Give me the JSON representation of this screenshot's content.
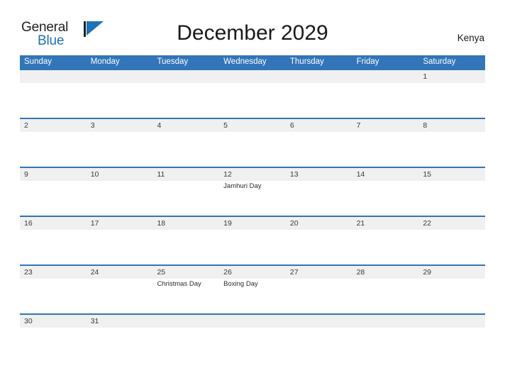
{
  "brand": {
    "name_part1": "General",
    "name_part2": "Blue",
    "mark": "triangle-flag-icon",
    "accent_color": "#1e72b8"
  },
  "header": {
    "title": "December 2029",
    "country": "Kenya"
  },
  "colors": {
    "header_blue": "#3275b8",
    "row_separator_blue": "#3275b8",
    "date_band_gray": "#f0f0f0",
    "cell_white": "#ffffff",
    "text_dark": "#1a1a1a"
  },
  "calendar": {
    "month": "December",
    "year": "2029",
    "weekday_headers": [
      "Sunday",
      "Monday",
      "Tuesday",
      "Wednesday",
      "Thursday",
      "Friday",
      "Saturday"
    ],
    "weeks": [
      {
        "days": [
          {
            "date": "",
            "event": ""
          },
          {
            "date": "",
            "event": ""
          },
          {
            "date": "",
            "event": ""
          },
          {
            "date": "",
            "event": ""
          },
          {
            "date": "",
            "event": ""
          },
          {
            "date": "",
            "event": ""
          },
          {
            "date": "1",
            "event": ""
          }
        ]
      },
      {
        "days": [
          {
            "date": "2",
            "event": ""
          },
          {
            "date": "3",
            "event": ""
          },
          {
            "date": "4",
            "event": ""
          },
          {
            "date": "5",
            "event": ""
          },
          {
            "date": "6",
            "event": ""
          },
          {
            "date": "7",
            "event": ""
          },
          {
            "date": "8",
            "event": ""
          }
        ]
      },
      {
        "days": [
          {
            "date": "9",
            "event": ""
          },
          {
            "date": "10",
            "event": ""
          },
          {
            "date": "11",
            "event": ""
          },
          {
            "date": "12",
            "event": "Jamhuri Day"
          },
          {
            "date": "13",
            "event": ""
          },
          {
            "date": "14",
            "event": ""
          },
          {
            "date": "15",
            "event": ""
          }
        ]
      },
      {
        "days": [
          {
            "date": "16",
            "event": ""
          },
          {
            "date": "17",
            "event": ""
          },
          {
            "date": "18",
            "event": ""
          },
          {
            "date": "19",
            "event": ""
          },
          {
            "date": "20",
            "event": ""
          },
          {
            "date": "21",
            "event": ""
          },
          {
            "date": "22",
            "event": ""
          }
        ]
      },
      {
        "days": [
          {
            "date": "23",
            "event": ""
          },
          {
            "date": "24",
            "event": ""
          },
          {
            "date": "25",
            "event": "Christmas Day"
          },
          {
            "date": "26",
            "event": "Boxing Day"
          },
          {
            "date": "27",
            "event": ""
          },
          {
            "date": "28",
            "event": ""
          },
          {
            "date": "29",
            "event": ""
          }
        ]
      },
      {
        "days": [
          {
            "date": "30",
            "event": ""
          },
          {
            "date": "31",
            "event": ""
          },
          {
            "date": "",
            "event": ""
          },
          {
            "date": "",
            "event": ""
          },
          {
            "date": "",
            "event": ""
          },
          {
            "date": "",
            "event": ""
          },
          {
            "date": "",
            "event": ""
          }
        ]
      }
    ]
  }
}
